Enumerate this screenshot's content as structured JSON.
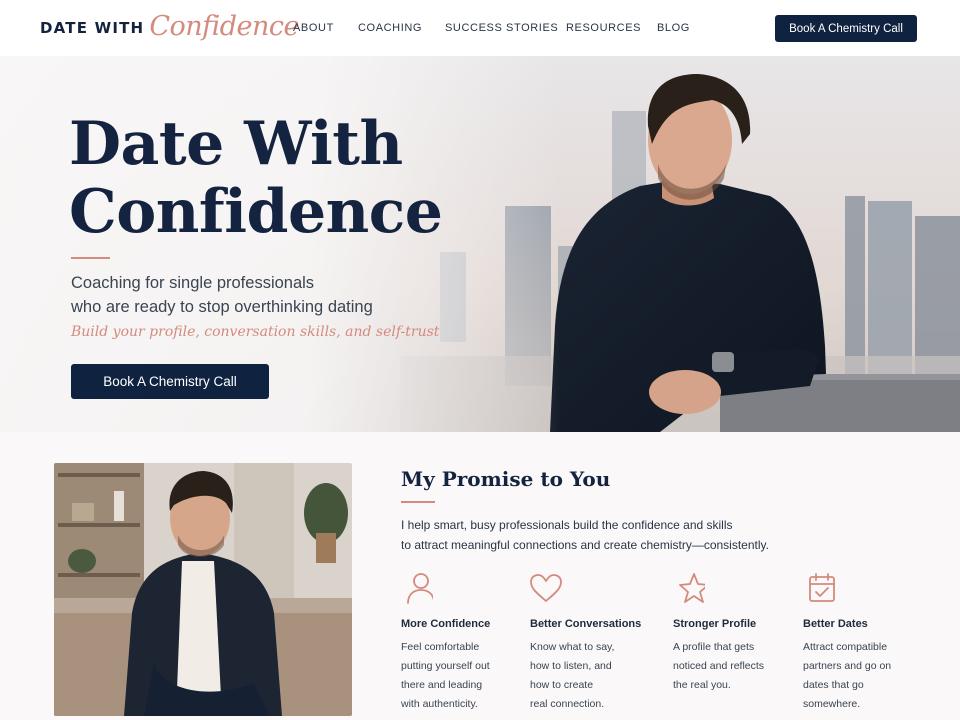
{
  "brand": {
    "part1": "DATE WITH",
    "part2": "Confidence"
  },
  "nav": {
    "items": [
      "ABOUT",
      "COACHING",
      "SUCCESS STORIES",
      "RESOURCES",
      "BLOG"
    ],
    "cta": "Book A Chemistry Call"
  },
  "hero": {
    "title_line1": "Date With",
    "title_line2": "Confidence",
    "subtitle_line1": "Coaching for single professionals",
    "subtitle_line2": "who are ready to stop overthinking dating",
    "tagline": "Build your profile, conversation skills, and self-trust",
    "button": "Book A Chemistry Call"
  },
  "promise": {
    "title": "My Promise to You",
    "text_line1": "I help smart, busy professionals build the confidence and skills",
    "text_line2": "to attract meaningful connections and create chemistry—consistently."
  },
  "features": [
    {
      "icon": "person-icon",
      "title": "More Confidence",
      "desc": "Feel comfortable\nputting yourself out\nthere and leading\nwith authenticity."
    },
    {
      "icon": "heart-icon",
      "title": "Better Conversations",
      "desc": "Know what to say,\nhow to listen, and\nhow to create\nreal connection."
    },
    {
      "icon": "star-icon",
      "title": "Stronger Profile",
      "desc": "A profile that gets\nnoticed and reflects\nthe real you."
    },
    {
      "icon": "calendar-check-icon",
      "title": "Better Dates",
      "desc": "Attract compatible\npartners and go on\ndates that go\nsomewhere."
    }
  ],
  "colors": {
    "navy": "#0f2340",
    "accent": "#d48a7d",
    "background": "#faf8f8"
  }
}
